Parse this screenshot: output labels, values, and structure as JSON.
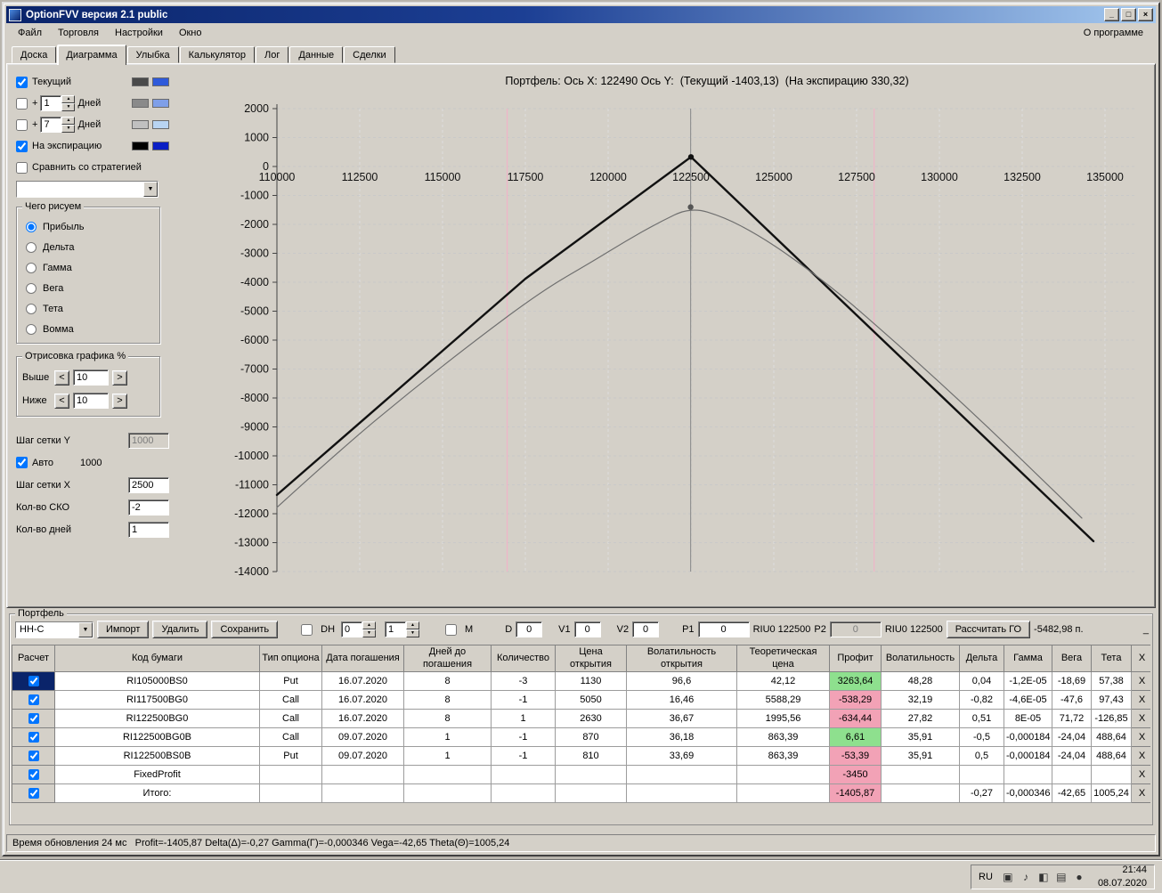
{
  "window": {
    "title": "OptionFVV версия 2.1 public",
    "menu": [
      "Файл",
      "Торговля",
      "Настройки",
      "Окно"
    ],
    "menu_right": "О программе"
  },
  "icons": {
    "chevron_down": "▼",
    "spin_up": "▲",
    "spin_down": "▼",
    "minimize": "_",
    "maximize": "□",
    "close": "×",
    "tray": [
      {
        "name": "tray-app-icon",
        "glyph": "▣"
      },
      {
        "name": "tray-volume-icon",
        "glyph": "♪"
      },
      {
        "name": "tray-display-icon",
        "glyph": "◧"
      },
      {
        "name": "tray-network-icon",
        "glyph": "▤"
      },
      {
        "name": "tray-status-icon",
        "glyph": "●"
      }
    ]
  },
  "tabs": {
    "items": [
      "Доска",
      "Диаграмма",
      "Улыбка",
      "Калькулятор",
      "Лог",
      "Данные",
      "Сделки"
    ],
    "active": "Диаграмма"
  },
  "sidebar": {
    "curves": [
      {
        "label": "Текущий",
        "checked": true,
        "swatches": [
          "#4a4a4a",
          "#2f5ada"
        ]
      },
      {
        "plus": "+",
        "value": "1",
        "label": "Дней",
        "checked": false,
        "swatches": [
          "#8a8a8a",
          "#7f9fe8"
        ]
      },
      {
        "plus": "+",
        "value": "7",
        "label": "Дней",
        "checked": false,
        "swatches": [
          "#c0c0c0",
          "#b8d4f2"
        ]
      },
      {
        "label": "На экспирацию",
        "checked": true,
        "swatches": [
          "#000000",
          "#0a1fc4"
        ]
      }
    ],
    "compare_label": "Сравнить со стратегией",
    "compare_checked": false,
    "strategy_value": "",
    "draw_group": {
      "title": "Чего рисуем",
      "options": [
        "Прибыль",
        "Дельта",
        "Гамма",
        "Вега",
        "Тета",
        "Вомма"
      ],
      "selected": "Прибыль"
    },
    "range_group": {
      "title": "Отрисовка графика %",
      "dec": "<",
      "inc": ">",
      "rows": [
        {
          "label": "Выше",
          "value": "10"
        },
        {
          "label": "Ниже",
          "value": "10"
        }
      ]
    },
    "grid_y_label": "Шаг сетки Y",
    "grid_y_value": "1000",
    "auto_label": "Авто",
    "auto_checked": true,
    "auto_value": "1000",
    "grid_x_label": "Шаг сетки X",
    "grid_x_value": "2500",
    "sko_label": "Кол-во СКО",
    "sko_value": "-2",
    "days_label": "Кол-во дней",
    "days_value": "1"
  },
  "chart_data": {
    "type": "line",
    "title": "Портфель: Ось X: 122490 Ось Y:  (Текущий -1403,13)  (На экспирацию 330,32)",
    "xlabel": "",
    "ylabel": "",
    "xlim": [
      110000,
      135800
    ],
    "ylim": [
      -14000,
      2000
    ],
    "grid": true,
    "x_ticks": [
      110000,
      112500,
      115000,
      117500,
      120000,
      122500,
      125000,
      127500,
      130000,
      132500,
      135000
    ],
    "y_ticks": [
      2000,
      1000,
      0,
      -1000,
      -2000,
      -3000,
      -4000,
      -5000,
      -6000,
      -7000,
      -8000,
      -9000,
      -10000,
      -11000,
      -12000,
      -13000,
      -14000
    ],
    "vlines": [
      {
        "x": 116950,
        "color": "#f0b4c8",
        "name": "sko-lower-line"
      },
      {
        "x": 128030,
        "color": "#f0b4c8",
        "name": "sko-upper-line"
      },
      {
        "x": 122490,
        "color": "#909090",
        "name": "current-price-line"
      }
    ],
    "series": [
      {
        "name": "na-ekspiratsiyu",
        "color": "#111111",
        "width": 2.4,
        "smooth": false,
        "points": [
          [
            110000,
            -11350
          ],
          [
            117500,
            -3880
          ],
          [
            122500,
            330
          ],
          [
            134650,
            -12950
          ]
        ]
      },
      {
        "name": "tekushchiy",
        "color": "#6f6f6f",
        "width": 1.2,
        "smooth": true,
        "points": [
          [
            110000,
            -11780
          ],
          [
            112000,
            -9700
          ],
          [
            114000,
            -7800
          ],
          [
            116000,
            -6000
          ],
          [
            118000,
            -4300
          ],
          [
            119500,
            -3300
          ],
          [
            120500,
            -2600
          ],
          [
            121500,
            -1950
          ],
          [
            122490,
            -1403
          ],
          [
            123500,
            -1750
          ],
          [
            124500,
            -2350
          ],
          [
            125500,
            -3100
          ],
          [
            127000,
            -4400
          ],
          [
            128500,
            -5900
          ],
          [
            130000,
            -7450
          ],
          [
            131500,
            -9050
          ],
          [
            133000,
            -10700
          ],
          [
            134300,
            -12150
          ]
        ]
      }
    ],
    "markers": [
      {
        "x": 122500,
        "y": 330,
        "color": "#111111",
        "name": "expiration-peak-point"
      },
      {
        "x": 122490,
        "y": -1403,
        "color": "#555555",
        "name": "current-value-point"
      }
    ]
  },
  "portfolio": {
    "title": "Портфель",
    "preset_value": "НН-С",
    "import_label": "Импорт",
    "delete_label": "Удалить",
    "save_label": "Сохранить",
    "dh_label": "DH",
    "dh_checked": false,
    "dh_spin1": "0",
    "dh_spin2": "1",
    "m_label": "M",
    "m_checked": false,
    "d_label": "D",
    "d_value": "0",
    "v1_label": "V1",
    "v1_value": "0",
    "v2_label": "V2",
    "v2_value": "0",
    "p1_label": "P1",
    "p1_value": "0",
    "riu1_label": "RIU0 122500",
    "p2_label": "P2",
    "p2_value": "0",
    "riu2_label": "RIU0 122500",
    "calc_label": "Рассчитать ГО",
    "go_value": "-5482,98 п.",
    "trailing_mark": "_",
    "table": {
      "headers": [
        "Расчет",
        "Код бумаги",
        "Тип опциона",
        "Дата погашения",
        "Дней до погашения",
        "Количество",
        "Цена открытия",
        "Волатильность открытия",
        "Теоретическая цена",
        "Профит",
        "Волатильность",
        "Дельта",
        "Гамма",
        "Вега",
        "Тета",
        "X"
      ],
      "close_label": "X",
      "rows": [
        {
          "checked": true,
          "selected": true,
          "profit_color": "green",
          "cells": [
            "RI105000BS0",
            "Put",
            "16.07.2020",
            "8",
            "-3",
            "1130",
            "96,6",
            "42,12",
            "3263,64",
            "48,28",
            "0,04",
            "-1,2E-05",
            "-18,69",
            "57,38"
          ]
        },
        {
          "checked": true,
          "selected": false,
          "profit_color": "pink",
          "cells": [
            "RI117500BG0",
            "Call",
            "16.07.2020",
            "8",
            "-1",
            "5050",
            "16,46",
            "5588,29",
            "-538,29",
            "32,19",
            "-0,82",
            "-4,6E-05",
            "-47,6",
            "97,43"
          ]
        },
        {
          "checked": true,
          "selected": false,
          "profit_color": "pink",
          "cells": [
            "RI122500BG0",
            "Call",
            "16.07.2020",
            "8",
            "1",
            "2630",
            "36,67",
            "1995,56",
            "-634,44",
            "27,82",
            "0,51",
            "8E-05",
            "71,72",
            "-126,85"
          ]
        },
        {
          "checked": true,
          "selected": false,
          "profit_color": "green",
          "cells": [
            "RI122500BG0B",
            "Call",
            "09.07.2020",
            "1",
            "-1",
            "870",
            "36,18",
            "863,39",
            "6,61",
            "35,91",
            "-0,5",
            "-0,000184",
            "-24,04",
            "488,64"
          ]
        },
        {
          "checked": true,
          "selected": false,
          "profit_color": "pink",
          "cells": [
            "RI122500BS0B",
            "Put",
            "09.07.2020",
            "1",
            "-1",
            "810",
            "33,69",
            "863,39",
            "-53,39",
            "35,91",
            "0,5",
            "-0,000184",
            "-24,04",
            "488,64"
          ]
        },
        {
          "checked": true,
          "selected": false,
          "profit_color": "pink",
          "cells": [
            "FixedProfit",
            "",
            "",
            "",
            "",
            "",
            "",
            "",
            "-3450",
            "",
            "",
            "",
            "",
            ""
          ]
        },
        {
          "checked": true,
          "selected": false,
          "profit_color": "pink",
          "cells": [
            "Итого:",
            "",
            "",
            "",
            "",
            "",
            "",
            "",
            "-1405,87",
            "",
            "-0,27",
            "-0,000346",
            "-42,65",
            "1005,24"
          ]
        }
      ]
    }
  },
  "colors": {
    "profit_green": "#8ee08e",
    "profit_pink": "#f2a2b6",
    "selection_blue": "#0a246a",
    "titlebar_blue": "#0a246a"
  },
  "status_bar": "Время обновления 24 мс   Profit=-1405,87 Delta(Δ)=-0,27 Gamma(Γ)=-0,000346 Vega=-42,65 Theta(Θ)=1005,24",
  "taskbar": {
    "lang": "RU",
    "time": "21:44",
    "date": "08.07.2020"
  }
}
